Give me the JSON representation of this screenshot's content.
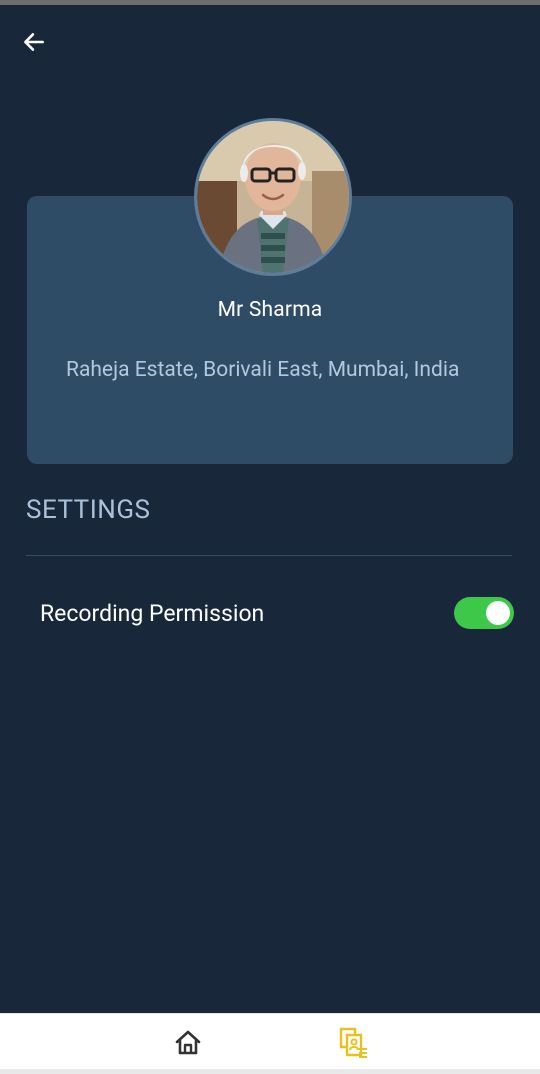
{
  "header": {
    "back_icon": "arrow-left-icon"
  },
  "profile": {
    "name": "Mr Sharma",
    "address": "Raheja Estate, Borivali East, Mumbai, India",
    "avatar_icon": "profile-photo"
  },
  "settings": {
    "heading": "SETTINGS",
    "items": [
      {
        "label": "Recording Permission",
        "enabled": true
      }
    ]
  },
  "bottom_nav": {
    "items": [
      {
        "icon": "home-icon",
        "active": false
      },
      {
        "icon": "documents-icon",
        "active": true
      }
    ]
  },
  "colors": {
    "background": "#18283a",
    "card": "#2f4c66",
    "toggle_on": "#3ec84a",
    "active_nav": "#e6c21e",
    "inactive_nav": "#333333"
  }
}
